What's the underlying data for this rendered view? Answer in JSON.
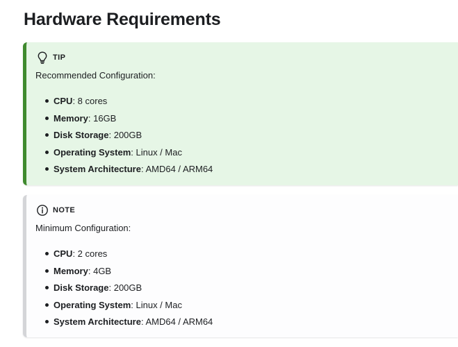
{
  "page": {
    "title": "Hardware Requirements"
  },
  "tip": {
    "icon": "lightbulb-icon",
    "label": "TIP",
    "intro": "Recommended Configuration:",
    "items": [
      {
        "key": "CPU",
        "value": ": 8 cores"
      },
      {
        "key": "Memory",
        "value": ": 16GB"
      },
      {
        "key": "Disk Storage",
        "value": ": 200GB"
      },
      {
        "key": "Operating System",
        "value": ": Linux / Mac"
      },
      {
        "key": "System Architecture",
        "value": ": AMD64 / ARM64"
      }
    ],
    "colors": {
      "background": "#e6f6e6",
      "border": "#3f8a2e"
    }
  },
  "note": {
    "icon": "info-circle-icon",
    "label": "NOTE",
    "intro": "Minimum Configuration:",
    "items": [
      {
        "key": "CPU",
        "value": ": 2 cores"
      },
      {
        "key": "Memory",
        "value": ": 4GB"
      },
      {
        "key": "Disk Storage",
        "value": ": 200GB"
      },
      {
        "key": "Operating System",
        "value": ": Linux / Mac"
      },
      {
        "key": "System Architecture",
        "value": ": AMD64 / ARM64"
      }
    ],
    "colors": {
      "background": "#fdfdfe",
      "border": "#d4d5d8"
    }
  }
}
